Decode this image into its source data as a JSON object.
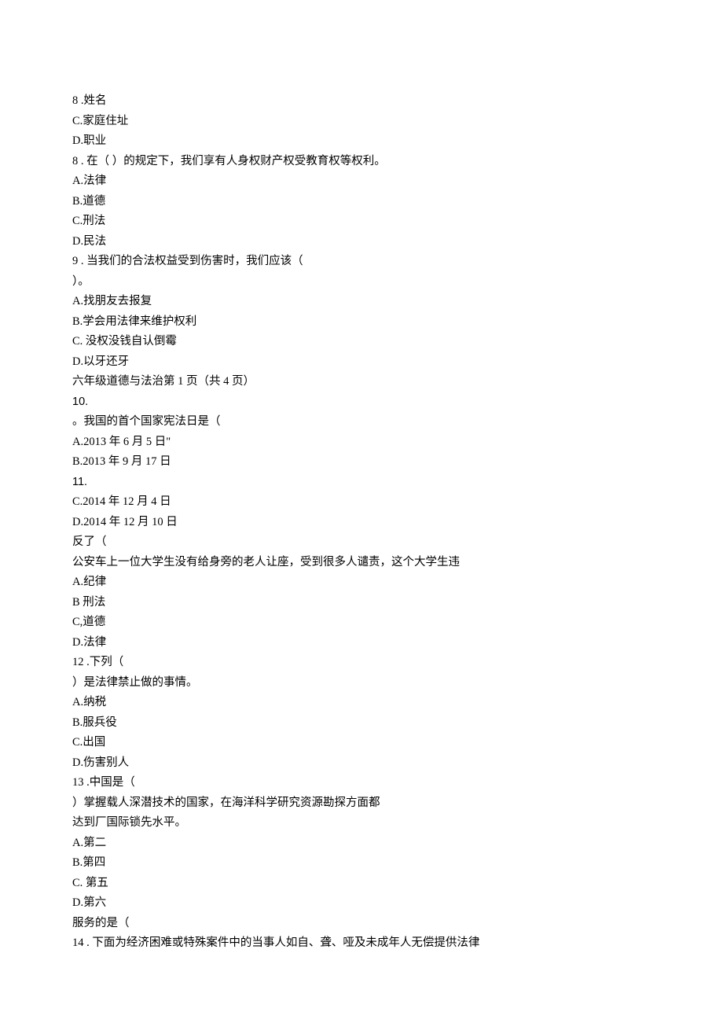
{
  "lines": [
    "8  .姓名",
    "C.家庭住址",
    "D.职业",
    "8  . 在（ ）的规定下，我们享有人身权财产权受教育权等权利。",
    "A.法律",
    "B.道德",
    "C.刑法",
    "D.民法",
    "9  . 当我们的合法权益受到伤害时，我们应该（",
    "）。",
    "A.找朋友去报复",
    "B.学会用法律来维护权利",
    "C.  没权没钱自认倒霉",
    "D.以牙还牙",
    "六年级道德与法治第 1 页（共 4 页）",
    "10.",
    "。我国的首个国家宪法日是（",
    "A.2013 年 6 月 5 日\"",
    "B.2013 年 9 月 17 日",
    "11.",
    "C.2014 年 12 月 4 日",
    "D.2014 年 12 月 10 日",
    "反了（",
    "公安车上一位大学生没有给身旁的老人让座，受到很多人谴责，这个大学生违",
    "A.纪律",
    "B 刑法",
    "C,道德",
    "D.法律",
    "12  .下列（",
    "）是法律禁止做的事情。",
    "A.纳税",
    "B.服兵役",
    "C.出国",
    "D.伤害别人",
    "13  .中国是（",
    "）掌握载人深潜技术的国家，在海洋科学研究资源勘探方面都",
    "达到厂国际锁先水平。",
    "A.第二",
    "B.第四",
    "C.  第五",
    "D.第六",
    "服务的是（",
    "14  . 下面为经济困难或特殊案件中的当事人如自、聋、哑及未成年人无偿提供法律"
  ]
}
